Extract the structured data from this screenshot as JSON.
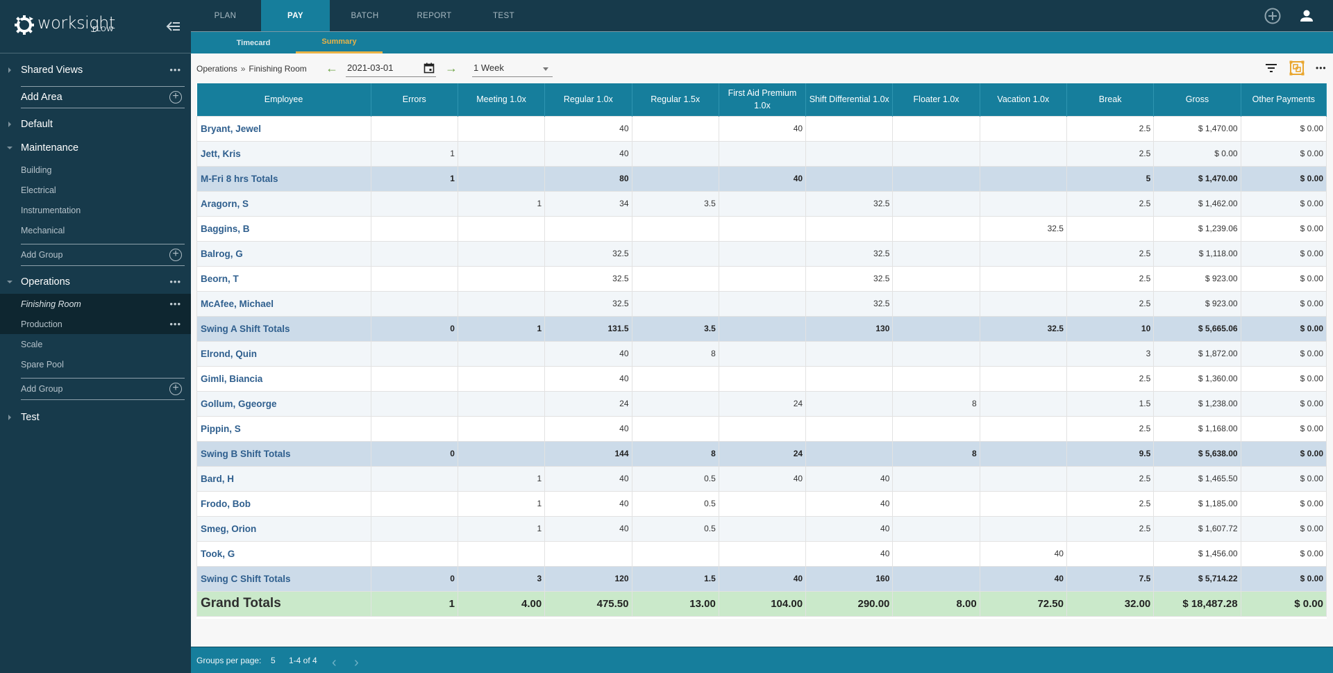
{
  "app": {
    "logo_text": "worksight",
    "logo_sub": "FLOW"
  },
  "sidebar": {
    "shared_views": "Shared Views",
    "add_area": "Add Area",
    "areas": [
      {
        "label": "Default",
        "expanded": false,
        "groups": []
      },
      {
        "label": "Maintenance",
        "expanded": true,
        "groups": [
          "Building",
          "Electrical",
          "Instrumentation",
          "Mechanical"
        ],
        "add_group": "Add Group"
      },
      {
        "label": "Operations",
        "expanded": true,
        "groups": [
          "Finishing Room",
          "Production",
          "Scale",
          "Spare Pool"
        ],
        "add_group": "Add Group",
        "selected_group": "Finishing Room"
      },
      {
        "label": "Test",
        "expanded": false,
        "groups": []
      }
    ]
  },
  "topnav": {
    "tabs": [
      "PLAN",
      "PAY",
      "BATCH",
      "REPORT",
      "TEST"
    ],
    "active_tab": "PAY",
    "subtabs": [
      "Timecard",
      "Summary"
    ],
    "active_subtab": "Summary"
  },
  "toolbar": {
    "breadcrumb": [
      "Operations",
      "Finishing Room"
    ],
    "breadcrumb_sep": "»",
    "date": "2021-03-01",
    "period": "1 Week"
  },
  "table": {
    "columns": [
      "Employee",
      "Errors",
      "Meeting 1.0x",
      "Regular 1.0x",
      "Regular 1.5x",
      "First Aid Premium 1.0x",
      "Shift Differential 1.0x",
      "Floater 1.0x",
      "Vacation 1.0x",
      "Break",
      "Gross",
      "Other Payments"
    ],
    "rows": [
      {
        "type": "emp",
        "cells": [
          "Bryant, Jewel",
          "",
          "",
          "40",
          "",
          "40",
          "",
          "",
          "",
          "2.5",
          "$ 1,470.00",
          "$ 0.00"
        ]
      },
      {
        "type": "emp",
        "cells": [
          "Jett, Kris",
          "1",
          "",
          "40",
          "",
          "",
          "",
          "",
          "",
          "2.5",
          "$ 0.00",
          "$ 0.00"
        ]
      },
      {
        "type": "total",
        "cells": [
          "M-Fri 8 hrs Totals",
          "1",
          "",
          "80",
          "",
          "40",
          "",
          "",
          "",
          "5",
          "$ 1,470.00",
          "$ 0.00"
        ]
      },
      {
        "type": "emp",
        "cells": [
          "Aragorn, S",
          "",
          "1",
          "34",
          "3.5",
          "",
          "32.5",
          "",
          "",
          "2.5",
          "$ 1,462.00",
          "$ 0.00"
        ]
      },
      {
        "type": "emp",
        "cells": [
          "Baggins, B",
          "",
          "",
          "",
          "",
          "",
          "",
          "",
          "32.5",
          "",
          "$ 1,239.06",
          "$ 0.00"
        ]
      },
      {
        "type": "emp",
        "cells": [
          "Balrog, G",
          "",
          "",
          "32.5",
          "",
          "",
          "32.5",
          "",
          "",
          "2.5",
          "$ 1,118.00",
          "$ 0.00"
        ]
      },
      {
        "type": "emp",
        "cells": [
          "Beorn, T",
          "",
          "",
          "32.5",
          "",
          "",
          "32.5",
          "",
          "",
          "2.5",
          "$ 923.00",
          "$ 0.00"
        ]
      },
      {
        "type": "emp",
        "cells": [
          "McAfee, Michael",
          "",
          "",
          "32.5",
          "",
          "",
          "32.5",
          "",
          "",
          "2.5",
          "$ 923.00",
          "$ 0.00"
        ]
      },
      {
        "type": "total",
        "cells": [
          "Swing A Shift Totals",
          "0",
          "1",
          "131.5",
          "3.5",
          "",
          "130",
          "",
          "32.5",
          "10",
          "$ 5,665.06",
          "$ 0.00"
        ]
      },
      {
        "type": "emp",
        "cells": [
          "Elrond, Quin",
          "",
          "",
          "40",
          "8",
          "",
          "",
          "",
          "",
          "3",
          "$ 1,872.00",
          "$ 0.00"
        ]
      },
      {
        "type": "emp",
        "cells": [
          "Gimli, Biancia",
          "",
          "",
          "40",
          "",
          "",
          "",
          "",
          "",
          "2.5",
          "$ 1,360.00",
          "$ 0.00"
        ]
      },
      {
        "type": "emp",
        "cells": [
          "Gollum, Ggeorge",
          "",
          "",
          "24",
          "",
          "24",
          "",
          "8",
          "",
          "1.5",
          "$ 1,238.00",
          "$ 0.00"
        ]
      },
      {
        "type": "emp",
        "cells": [
          "Pippin, S",
          "",
          "",
          "40",
          "",
          "",
          "",
          "",
          "",
          "2.5",
          "$ 1,168.00",
          "$ 0.00"
        ]
      },
      {
        "type": "total",
        "cells": [
          "Swing B Shift Totals",
          "0",
          "",
          "144",
          "8",
          "24",
          "",
          "8",
          "",
          "9.5",
          "$ 5,638.00",
          "$ 0.00"
        ]
      },
      {
        "type": "emp",
        "cells": [
          "Bard, H",
          "",
          "1",
          "40",
          "0.5",
          "40",
          "40",
          "",
          "",
          "2.5",
          "$ 1,465.50",
          "$ 0.00"
        ]
      },
      {
        "type": "emp",
        "cells": [
          "Frodo, Bob",
          "",
          "1",
          "40",
          "0.5",
          "",
          "40",
          "",
          "",
          "2.5",
          "$ 1,185.00",
          "$ 0.00"
        ]
      },
      {
        "type": "emp",
        "cells": [
          "Smeg, Orion",
          "",
          "1",
          "40",
          "0.5",
          "",
          "40",
          "",
          "",
          "2.5",
          "$ 1,607.72",
          "$ 0.00"
        ]
      },
      {
        "type": "emp",
        "cells": [
          "Took, G",
          "",
          "",
          "",
          "",
          "",
          "40",
          "",
          "40",
          "",
          "$ 1,456.00",
          "$ 0.00"
        ]
      },
      {
        "type": "total",
        "cells": [
          "Swing C Shift Totals",
          "0",
          "3",
          "120",
          "1.5",
          "40",
          "160",
          "",
          "40",
          "7.5",
          "$ 5,714.22",
          "$ 0.00"
        ]
      },
      {
        "type": "grand",
        "cells": [
          "Grand Totals",
          "1",
          "4.00",
          "475.50",
          "13.00",
          "104.00",
          "290.00",
          "8.00",
          "72.50",
          "32.00",
          "$ 18,487.28",
          "$ 0.00"
        ]
      }
    ]
  },
  "footer": {
    "groups_per_page_label": "Groups per page:",
    "groups_per_page": "5",
    "range": "1-4 of 4"
  },
  "colors": {
    "sidebar_bg": "#173a4b",
    "accent": "#167e9c",
    "active_subtab": "#e9b347",
    "total_row": "#ccdbe9",
    "grand_row": "#cae9ca",
    "arrow_green": "#6aa241"
  }
}
